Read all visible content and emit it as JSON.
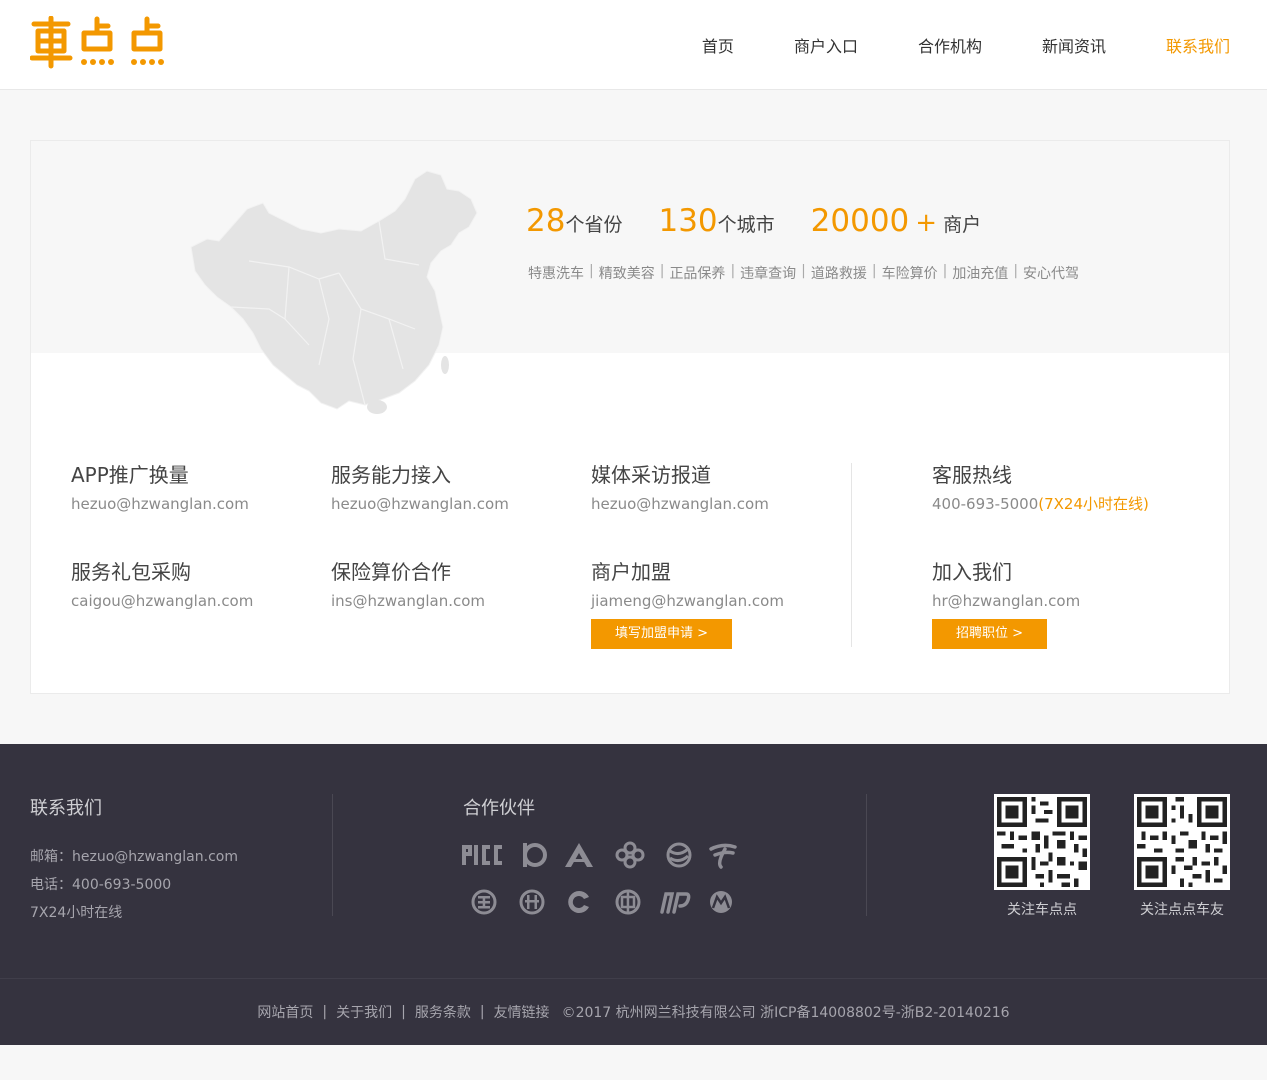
{
  "brand": {
    "logo_text": "車点点",
    "accent": "#f39800"
  },
  "nav": [
    {
      "label": "首页",
      "active": false
    },
    {
      "label": "商户入口",
      "active": false
    },
    {
      "label": "合作机构",
      "active": false
    },
    {
      "label": "新闻资讯",
      "active": false
    },
    {
      "label": "联系我们",
      "active": true
    }
  ],
  "hero": {
    "stats": [
      {
        "num": "28",
        "unit": "个省份"
      },
      {
        "num": "130",
        "unit": "个城市"
      },
      {
        "num": "20000",
        "plus": "+",
        "unit": "商户"
      }
    ],
    "services": [
      "特惠洗车",
      "精致美容",
      "正品保养",
      "违章查询",
      "道路救援",
      "车险算价",
      "加油充值",
      "安心代驾"
    ]
  },
  "contacts": {
    "app": {
      "title": "APP推广换量",
      "mail": "hezuo@hzwanglan.com"
    },
    "service": {
      "title": "服务能力接入",
      "mail": "hezuo@hzwanglan.com"
    },
    "media": {
      "title": "媒体采访报道",
      "mail": "hezuo@hzwanglan.com"
    },
    "hotline": {
      "title": "客服热线",
      "phone": "400-693-5000",
      "hours": "(7X24小时在线)"
    },
    "gift": {
      "title": "服务礼包采购",
      "mail": "caigou@hzwanglan.com"
    },
    "insurance": {
      "title": "保险算价合作",
      "mail": "ins@hzwanglan.com"
    },
    "join_merchant": {
      "title": "商户加盟",
      "mail": "jiameng@hzwanglan.com",
      "button": "填写加盟申请 >"
    },
    "join_us": {
      "title": "加入我们",
      "mail": "hr@hzwanglan.com",
      "button": "招聘职位 >"
    }
  },
  "footer": {
    "contact_title": "联系我们",
    "email": "邮箱：hezuo@hzwanglan.com",
    "phone": "电话：400-693-5000",
    "hours": "7X24小时在线",
    "partners_title": "合作伙伴",
    "qr1_caption": "关注车点点",
    "qr2_caption": "关注点点车友",
    "links": [
      "网站首页",
      "关于我们",
      "服务条款",
      "友情链接"
    ],
    "copyright": "©2017 杭州网兰科技有限公司  浙ICP备14008802号-浙B2-20140216"
  }
}
